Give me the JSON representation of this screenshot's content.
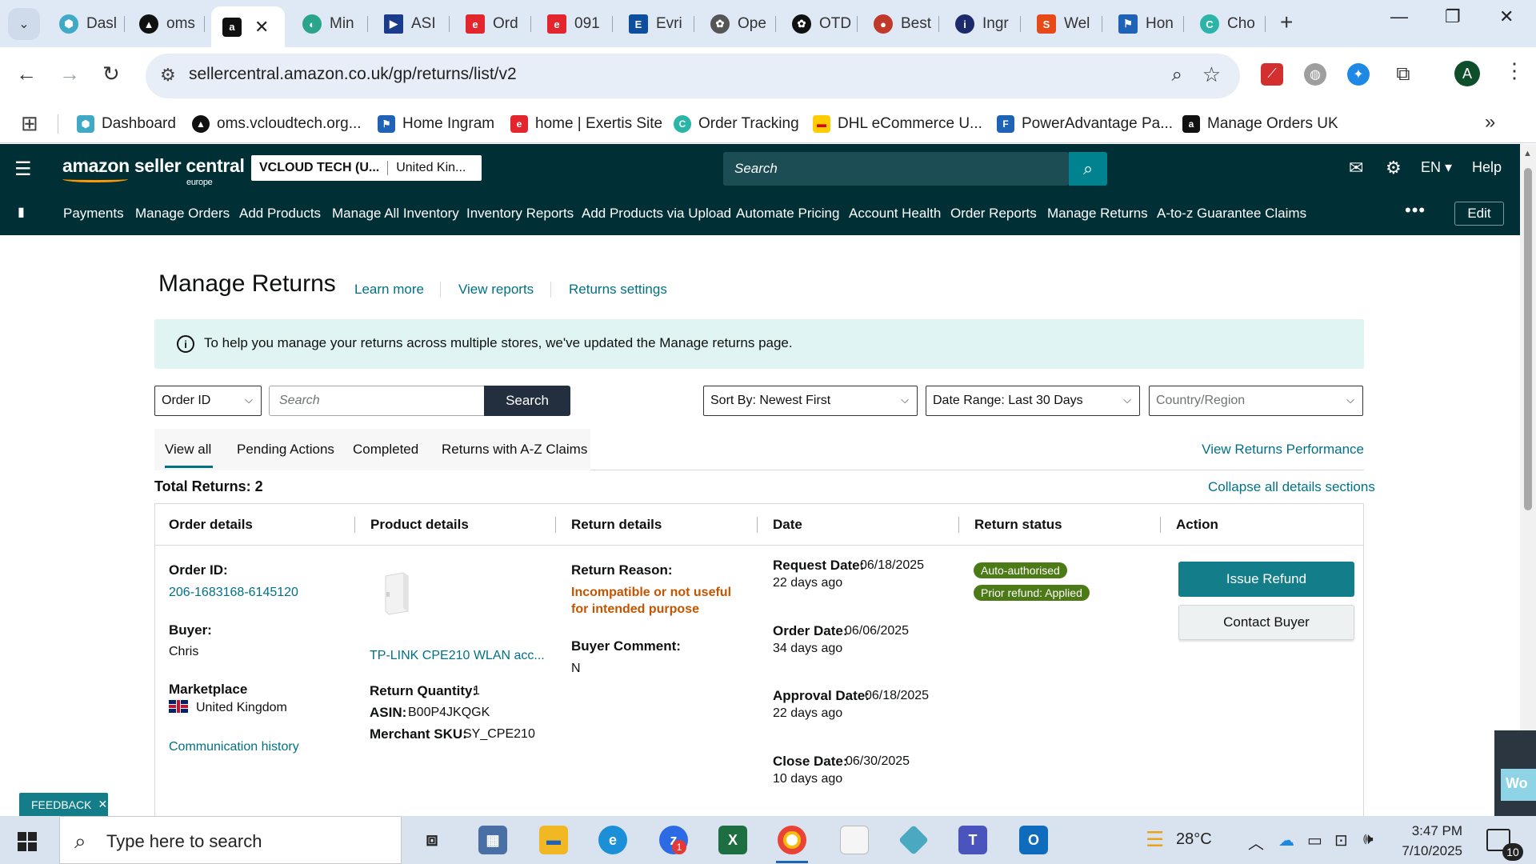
{
  "browser": {
    "tabs": [
      {
        "label": "Dasl",
        "icon": "hexagon-icon",
        "color": "#3fa9c6"
      },
      {
        "label": "oms",
        "icon": "triangle-icon",
        "color": "#111111"
      },
      {
        "label": "",
        "icon": "amazon-icon",
        "color": "#111111",
        "active": true,
        "close": "✕"
      },
      {
        "label": "Min",
        "icon": "leaf-icon",
        "color": "#2aa58b"
      },
      {
        "label": "ASI",
        "icon": "play-icon",
        "color": "#1b3c8c"
      },
      {
        "label": "Ord",
        "icon": "exertis-icon",
        "color": "#e3262d"
      },
      {
        "label": "091",
        "icon": "exertis-icon",
        "color": "#e3262d"
      },
      {
        "label": "Evri",
        "icon": "evri-icon",
        "color": "#0d4f9e"
      },
      {
        "label": "Ope",
        "icon": "openai-icon",
        "color": "#333333"
      },
      {
        "label": "OTD",
        "icon": "openai-icon",
        "color": "#111111"
      },
      {
        "label": "Best",
        "icon": "bulb-icon",
        "color": "#c0392b"
      },
      {
        "label": "Ingr",
        "icon": "ingram-icon",
        "color": "#1c2a6b"
      },
      {
        "label": "Wel",
        "icon": "wave-icon",
        "color": "#e64a19"
      },
      {
        "label": "Hon",
        "icon": "flag-icon",
        "color": "#1e63b6"
      },
      {
        "label": "Cho",
        "icon": "refresh-circle-icon",
        "color": "#2bb5a8"
      }
    ],
    "new_tab": "+",
    "url": "sellercentral.amazon.co.uk/gp/returns/list/v2",
    "profile_initial": "A",
    "bookmarks": [
      {
        "label": "Dashboard",
        "icon": "hexagon-icon",
        "color": "#3fa9c6"
      },
      {
        "label": "oms.vcloudtech.org...",
        "icon": "triangle-icon",
        "color": "#111111"
      },
      {
        "label": "Home Ingram",
        "icon": "flag-icon",
        "color": "#1e63b6"
      },
      {
        "label": "home | Exertis Site",
        "icon": "exertis-icon",
        "color": "#e3262d"
      },
      {
        "label": "Order Tracking",
        "icon": "refresh-circle-icon",
        "color": "#2bb5a8"
      },
      {
        "label": "DHL eCommerce U...",
        "icon": "dhl-icon",
        "color": "#ffcc00"
      },
      {
        "label": "PowerAdvantage Pa...",
        "icon": "doc-icon",
        "color": "#1e63b6"
      },
      {
        "label": "Manage Orders UK",
        "icon": "amazon-icon",
        "color": "#111111"
      }
    ]
  },
  "header": {
    "logo": "amazon seller central",
    "logo_sub": "europe",
    "account_name": "VCLOUD TECH (U...",
    "account_region": "United Kin...",
    "search_placeholder": "Search",
    "language": "EN ▾",
    "help": "Help"
  },
  "nav": {
    "items": [
      "Payments",
      "Manage Orders",
      "Add Products",
      "Manage All Inventory",
      "Inventory Reports",
      "Add Products via Upload",
      "Automate Pricing",
      "Account Health",
      "Order Reports",
      "Manage Returns",
      "A-to-z Guarantee Claims"
    ],
    "more": "•••",
    "edit": "Edit"
  },
  "page": {
    "title": "Manage Returns",
    "links": [
      "Learn more",
      "View reports",
      "Returns settings"
    ],
    "banner": "To help you manage your returns across multiple stores, we've updated the Manage returns page.",
    "filters": {
      "search_type": "Order ID",
      "search_placeholder": "Search",
      "search_button": "Search",
      "sort": "Sort By: Newest First",
      "date_range": "Date Range: Last 30 Days",
      "country": "Country/Region"
    },
    "tabs": [
      "View all",
      "Pending Actions",
      "Completed",
      "Returns with A-Z Claims"
    ],
    "performance_link": "View Returns Performance",
    "total": "Total Returns: 2",
    "collapse_link": "Collapse all details sections",
    "columns": [
      "Order details",
      "Product details",
      "Return details",
      "Date",
      "Return status",
      "Action"
    ]
  },
  "row": {
    "order_id_label": "Order ID:",
    "order_id": "206-1683168-6145120",
    "buyer_label": "Buyer:",
    "buyer": "Chris",
    "marketplace_label": "Marketplace",
    "marketplace": "United Kingdom",
    "comm_history": "Communication history",
    "product_name": "TP-LINK CPE210 WLAN acc...",
    "qty_label": "Return Quantity:",
    "qty": "1",
    "asin_label": "ASIN:",
    "asin": "B00P4JKQGK",
    "sku_label": "Merchant SKU:",
    "sku": "SY_CPE210",
    "reason_label": "Return Reason:",
    "reason": "Incompatible or not useful for intended purpose",
    "comment_label": "Buyer Comment:",
    "comment": "N",
    "request_label": "Request Date:",
    "request_date": "06/18/2025",
    "request_ago": "22 days ago",
    "order_label": "Order Date:",
    "order_date": "06/06/2025",
    "order_ago": "34 days ago",
    "approval_label": "Approval Date:",
    "approval_date": "06/18/2025",
    "approval_ago": "22 days ago",
    "close_label": "Close Date:",
    "close_date": "06/30/2025",
    "close_ago": "10 days ago",
    "status_badges": [
      "Auto-authorised",
      "Prior refund: Applied"
    ],
    "issue_refund": "Issue Refund",
    "contact_buyer": "Contact Buyer"
  },
  "feedback": "FEEDBACK",
  "side_widget_text": "Wo",
  "taskbar": {
    "search_placeholder": "Type here to search",
    "zoom_badge": "1",
    "temperature": "28°C",
    "time": "3:47 PM",
    "date": "7/10/2025",
    "notifications": "10"
  },
  "colors": {
    "header_bg": "#002f36",
    "link": "#007185",
    "primary_button": "#137e8a",
    "reason": "#c45500",
    "badge": "#4c7a17",
    "banner": "#e1f4f4"
  }
}
